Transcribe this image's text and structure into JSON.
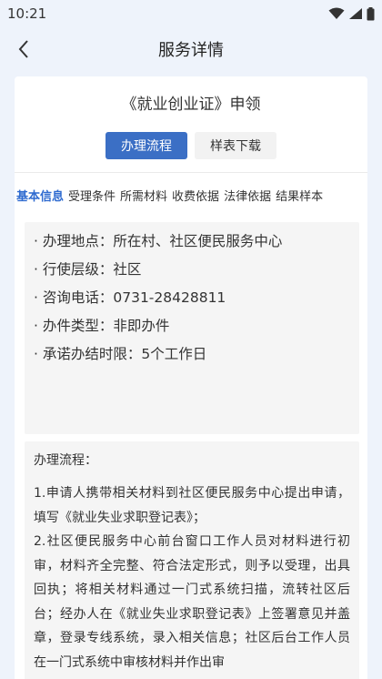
{
  "status_bar": {
    "time": "10:21",
    "icons": [
      "wifi-icon",
      "signal-icon",
      "battery-icon"
    ]
  },
  "nav": {
    "title": "服务详情"
  },
  "card": {
    "title": "《就业创业证》申领",
    "buttons": {
      "process": "办理流程",
      "download": "样表下载"
    },
    "tabs": [
      {
        "label": "基本信息",
        "active": true
      },
      {
        "label": "受理条件",
        "active": false
      },
      {
        "label": "所需材料",
        "active": false
      },
      {
        "label": "收费依据",
        "active": false
      },
      {
        "label": "法律依据",
        "active": false
      },
      {
        "label": "结果样本",
        "active": false
      }
    ],
    "info": [
      "· 办理地点：所在村、社区便民服务中心",
      "· 行使层级：社区",
      "· 咨询电话：0731-28428811",
      "· 办件类型：非即办件",
      "· 承诺办结时限：5个工作日"
    ],
    "process": {
      "heading": "办理流程：",
      "steps": [
        "1.申请人携带相关材料到社区便民服务中心提出申请，填写《就业失业求职登记表》；",
        "2.社区便民服务中心前台窗口工作人员对材料进行初审，材料齐全完整、符合法定形式，则予以受理，出具回执；将相关材料通过一门式系统扫描，流转社区后台；经办人在《就业失业求职登记表》上签署意见并盖章，登录专线系统，录入相关信息；社区后台工作人员在一门式系统中审核材料并作出审"
      ]
    }
  },
  "colors": {
    "accent": "#3b6fc5",
    "tab_active": "#2f6bd0",
    "background": "#eef3fb"
  }
}
